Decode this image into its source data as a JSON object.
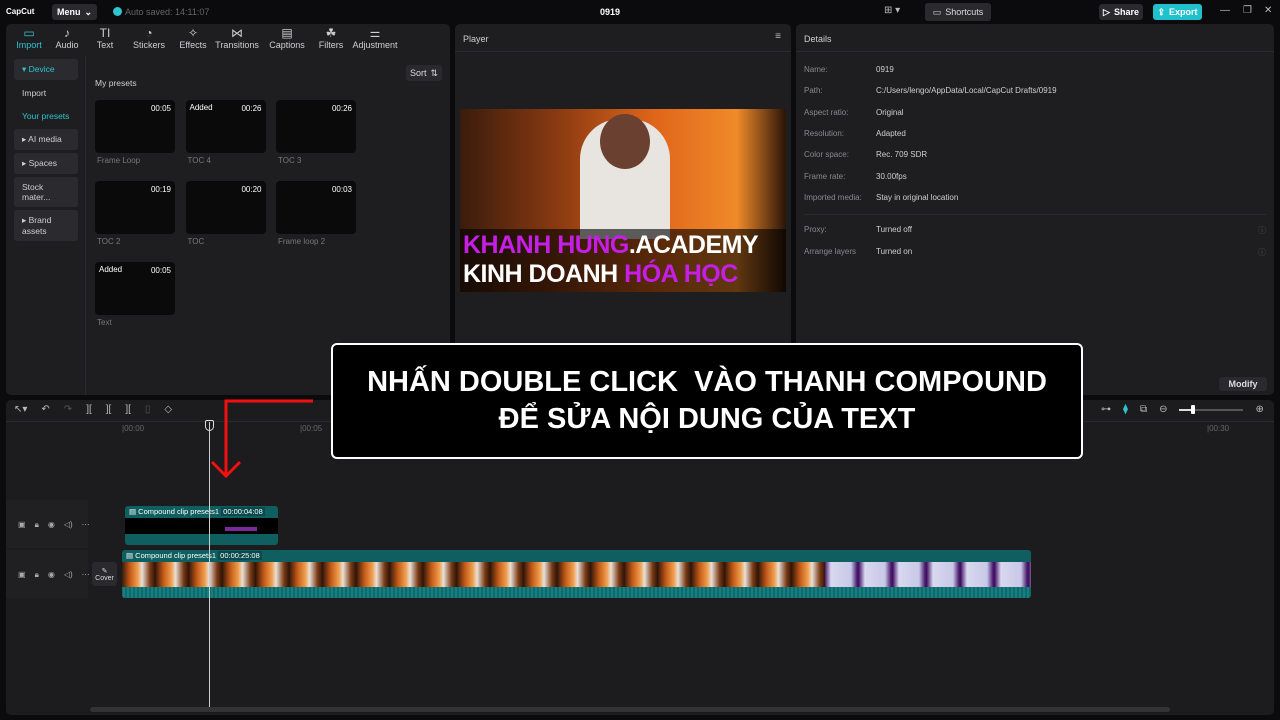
{
  "app": {
    "logo": "CapCut",
    "menu": "Menu",
    "autosave": "Auto saved: 14:11:07",
    "title": "0919",
    "shortcuts": "Shortcuts",
    "share": "Share",
    "export": "Export",
    "accent": "#2fc4cf"
  },
  "tabs": [
    {
      "label": "Import",
      "icon": "▭"
    },
    {
      "label": "Audio",
      "icon": "♪"
    },
    {
      "label": "Text",
      "icon": "TI"
    },
    {
      "label": "Stickers",
      "icon": "◔"
    },
    {
      "label": "Effects",
      "icon": "✧"
    },
    {
      "label": "Transitions",
      "icon": "⋈"
    },
    {
      "label": "Captions",
      "icon": "▤"
    },
    {
      "label": "Filters",
      "icon": "☘"
    },
    {
      "label": "Adjustment",
      "icon": "⚌"
    }
  ],
  "sidebar": {
    "items": [
      "▾ Device",
      "Import",
      "Your presets",
      "▸ AI media",
      "▸ Spaces",
      "Stock mater...",
      "▸ Brand assets"
    ]
  },
  "presets": {
    "title": "My presets",
    "sort": "Sort",
    "cards": [
      {
        "name": "Frame Loop",
        "duration": "00:05",
        "added": ""
      },
      {
        "name": "TOC 4",
        "duration": "00:26",
        "added": "Added"
      },
      {
        "name": "TOC 3",
        "duration": "00:26",
        "added": ""
      },
      {
        "name": "TOC 2",
        "duration": "00:19",
        "added": ""
      },
      {
        "name": "TOC",
        "duration": "00:20",
        "added": ""
      },
      {
        "name": "Frame loop 2",
        "duration": "00:03",
        "added": ""
      },
      {
        "name": "Text",
        "duration": "00:05",
        "added": "Added"
      }
    ]
  },
  "player": {
    "title": "Player",
    "video_line1a": "KHANH HUNG",
    "video_line1b": ".ACADEMY",
    "video_line2a": "KINH DOANH ",
    "video_line2b": "HÓA HỌC"
  },
  "details": {
    "title": "Details",
    "rows": [
      {
        "k": "Name:",
        "v": "0919"
      },
      {
        "k": "Path:",
        "v": "C:/Users/lengo/AppData/Local/CapCut Drafts/0919"
      },
      {
        "k": "Aspect ratio:",
        "v": "Original"
      },
      {
        "k": "Resolution:",
        "v": "Adapted"
      },
      {
        "k": "Color space:",
        "v": "Rec. 709 SDR"
      },
      {
        "k": "Frame rate:",
        "v": "30.00fps"
      },
      {
        "k": "Imported media:",
        "v": "Stay in original location"
      }
    ],
    "rows2": [
      {
        "k": "Proxy:",
        "v": "Turned off"
      },
      {
        "k": "Arrange layers",
        "v": "Turned on"
      }
    ],
    "modify": "Modify"
  },
  "timeline": {
    "ticks": [
      "|00:00",
      "|00:05",
      "|00:30"
    ],
    "cover": "Cover",
    "clip1": {
      "name": "Compound clip presets1",
      "duration": "00:00:04:08"
    },
    "clip2": {
      "name": "Compound clip presets1",
      "duration": "00:00:25:08"
    }
  },
  "overlay": {
    "line1": "NHẤN DOUBLE CLICK  VÀO THANH COMPOUND",
    "line2": "ĐỂ SỬA NỘI DUNG CỦA TEXT"
  }
}
